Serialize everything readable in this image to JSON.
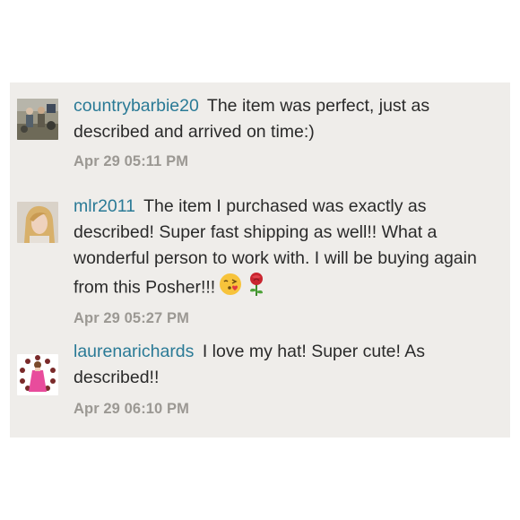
{
  "comments": [
    {
      "username": "countrybarbie20",
      "text": "The item was perfect, just as described and arrived on time:)",
      "timestamp": "Apr 29 05:11 PM",
      "avatar": "user-photo-outdoors"
    },
    {
      "username": "mlr2011",
      "text": "The item I purchased was exactly as described! Super fast shipping as well!! What a wonderful person to work with. I will be buying again from this Posher!!!",
      "timestamp": "Apr 29 05:27 PM",
      "avatar": "user-photo-portrait",
      "emojis": [
        "kissing-face-blowing-kiss-icon",
        "rose-icon"
      ]
    },
    {
      "username": "laurenarichards",
      "text": "I love my hat! Super cute! As described!!",
      "timestamp": "Apr 29 06:10 PM",
      "avatar": "user-photo-pink-dress"
    }
  ],
  "colors": {
    "card_background": "#efedea",
    "username": "#2a7a96",
    "body_text": "#2a2a2a",
    "timestamp": "#9b9893"
  }
}
